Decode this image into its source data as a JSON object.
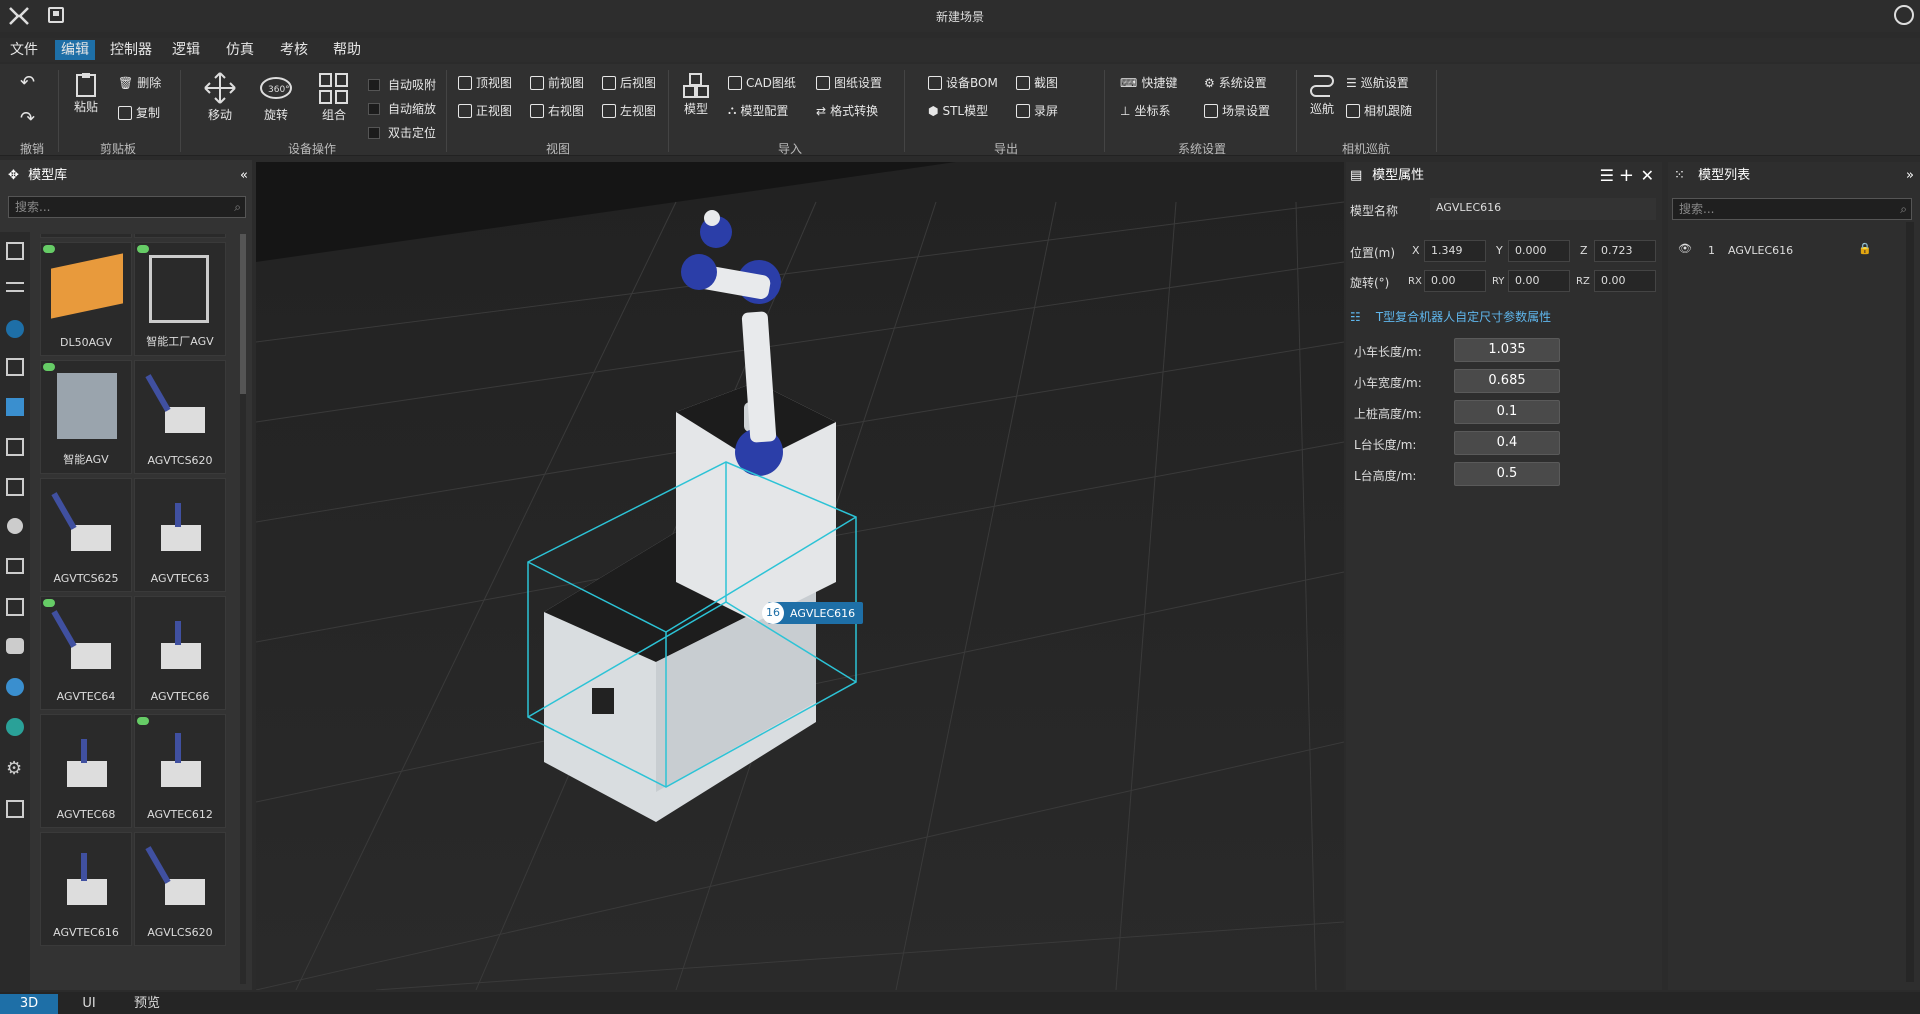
{
  "app": {
    "title": "新建场景"
  },
  "menu": [
    "文件",
    "编辑",
    "控制器",
    "逻辑",
    "仿真",
    "考核",
    "帮助"
  ],
  "ribbon": {
    "undo_group": "撤销",
    "clipboard": {
      "paste": "粘贴",
      "delete": "删除",
      "copy": "复制",
      "group": "剪贴板"
    },
    "device_ops": {
      "move": "移动",
      "rotate": "旋转",
      "combine": "组合",
      "auto_snap": "自动吸附",
      "auto_scale": "自动缩放",
      "dbl_locate": "双击定位",
      "group": "设备操作"
    },
    "view": {
      "top": "顶视图",
      "front": "前视图",
      "back": "后视图",
      "main": "正视图",
      "right": "右视图",
      "left": "左视图",
      "group": "视图"
    },
    "import": {
      "model": "模型",
      "cad": "CAD图纸",
      "model_cfg": "模型配置",
      "drawing_set": "图纸设置",
      "format_conv": "格式转换",
      "group": "导入"
    },
    "export": {
      "bom": "设备BOM",
      "stl": "STL模型",
      "screenshot": "截图",
      "record": "录屏",
      "group": "导出"
    },
    "system": {
      "shortcut": "快捷键",
      "coord": "坐标系",
      "sys_set": "系统设置",
      "scene_set": "场景设置",
      "group": "系统设置"
    },
    "cruise": {
      "cruise": "巡航",
      "cruise_set": "巡航设置",
      "cam_follow": "相机跟随",
      "group": "相机巡航"
    }
  },
  "library": {
    "title": "模型库",
    "search_placeholder": "搜索...",
    "cards": [
      "DL50AGV",
      "智能工厂AGV",
      "智能AGV",
      "AGVTCS620",
      "AGVTCS625",
      "AGVTEC63",
      "AGVTEC64",
      "AGVTEC66",
      "AGVTEC68",
      "AGVTEC612",
      "AGVTEC616",
      "AGVLCS620"
    ]
  },
  "viewport": {
    "tag_number": "16",
    "tag_label": "AGVLEC616"
  },
  "properties": {
    "title": "模型属性",
    "name_label": "模型名称",
    "name_value": "AGVLEC616",
    "pos_label": "位置(m)",
    "rot_label": "旋转(°)",
    "x_label": "X",
    "y_label": "Y",
    "z_label": "Z",
    "rx_label": "RX",
    "ry_label": "RY",
    "rz_label": "RZ",
    "x": "1.349",
    "y": "0.000",
    "z": "0.723",
    "rx": "0.00",
    "ry": "0.00",
    "rz": "0.00",
    "section": "T型复合机器人自定尺寸参数属性",
    "params": [
      {
        "label": "小车长度/m:",
        "value": "1.035"
      },
      {
        "label": "小车宽度/m:",
        "value": "0.685"
      },
      {
        "label": "上桩高度/m:",
        "value": "0.1"
      },
      {
        "label": "L台长度/m:",
        "value": "0.4"
      },
      {
        "label": "L台高度/m:",
        "value": "0.5"
      }
    ]
  },
  "model_list": {
    "title": "模型列表",
    "search_placeholder": "搜索...",
    "items": [
      {
        "index": "1",
        "name": "AGVLEC616"
      }
    ]
  },
  "status_tabs": [
    "3D",
    "UI",
    "预览"
  ]
}
